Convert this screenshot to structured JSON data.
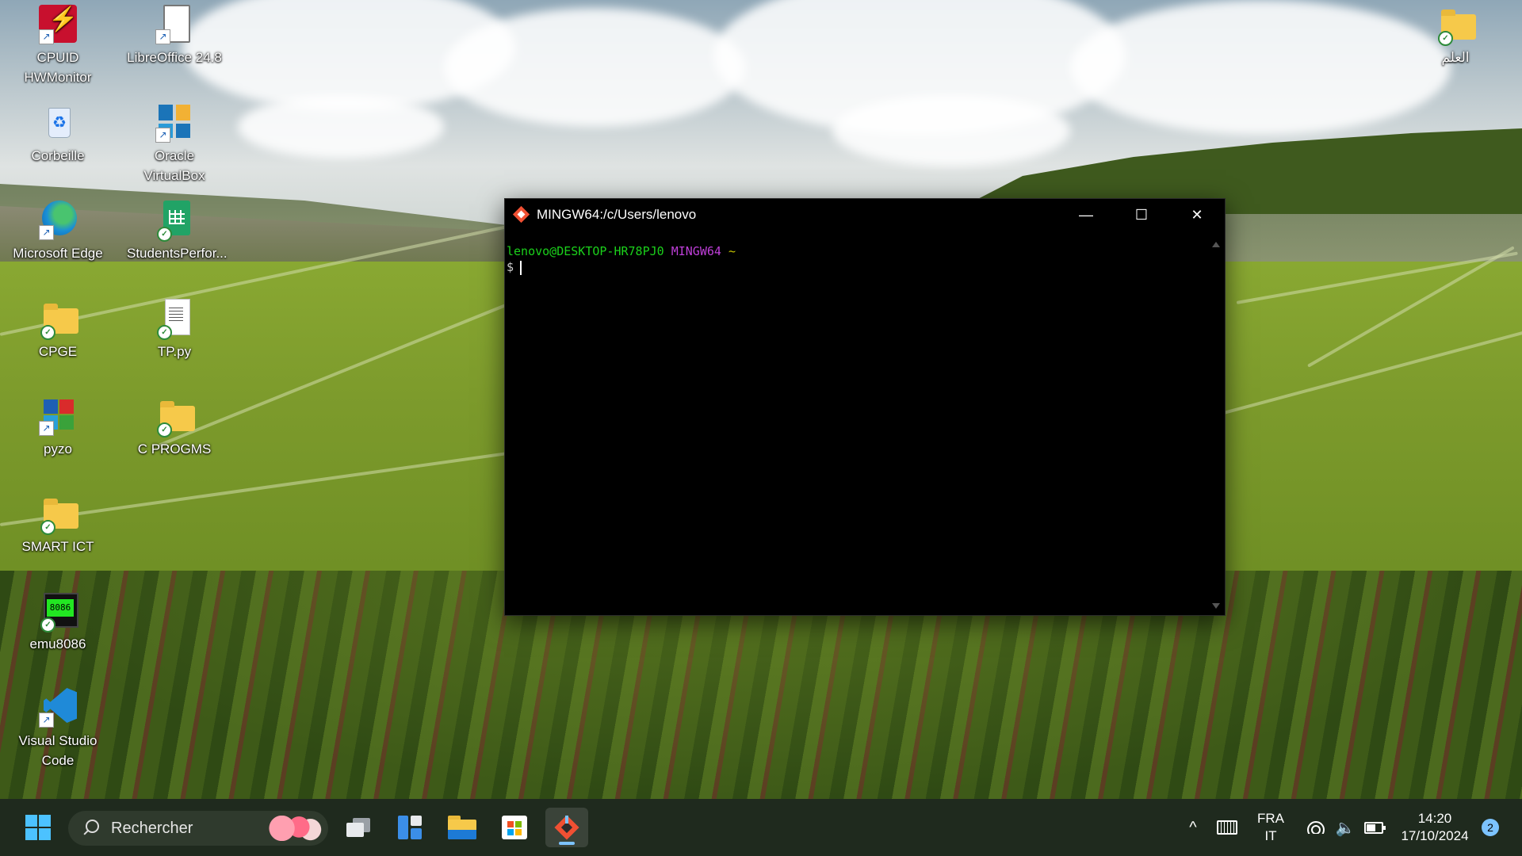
{
  "desktop_icons": [
    {
      "id": "hwmonitor",
      "label_line1": "CPUID",
      "label_line2": "HWMonitor"
    },
    {
      "id": "libreoffice",
      "label": "LibreOffice 24.8"
    },
    {
      "id": "folder_arabic",
      "label": "العلم"
    },
    {
      "id": "recycle",
      "label": "Corbeille"
    },
    {
      "id": "virtualbox",
      "label": "Oracle VirtualBox"
    },
    {
      "id": "edge",
      "label": "Microsoft Edge"
    },
    {
      "id": "students",
      "label": "StudentsPerfor..."
    },
    {
      "id": "cpge",
      "label": "CPGE"
    },
    {
      "id": "tppy",
      "label": "TP.py"
    },
    {
      "id": "pyzo",
      "label": "pyzo"
    },
    {
      "id": "cprogms",
      "label": "C PROGMS"
    },
    {
      "id": "smartict",
      "label": "SMART ICT"
    },
    {
      "id": "emu8086",
      "label": "emu8086",
      "badge": "8086"
    },
    {
      "id": "vscode",
      "label_line1": "Visual Studio",
      "label_line2": "Code"
    }
  ],
  "terminal": {
    "title": "MINGW64:/c/Users/lenovo",
    "prompt_user": "lenovo@DESKTOP-HR78PJ0",
    "prompt_env": "MINGW64",
    "prompt_dir": "~",
    "prompt_symbol": "$",
    "minimize_glyph": "—",
    "maximize_glyph": "☐",
    "close_glyph": "✕"
  },
  "taskbar": {
    "search_placeholder": "Rechercher",
    "lang_top": "FRA",
    "lang_bottom": "IT",
    "time": "14:20",
    "date": "17/10/2024",
    "notification_count": "2",
    "chevron": "^"
  },
  "colors": {
    "prompt_user": "#1bd11b",
    "prompt_env": "#bf3fd9",
    "prompt_dir": "#c7c400",
    "taskbar_bg": "#1f2a1e",
    "accent": "#7cc3ff"
  }
}
